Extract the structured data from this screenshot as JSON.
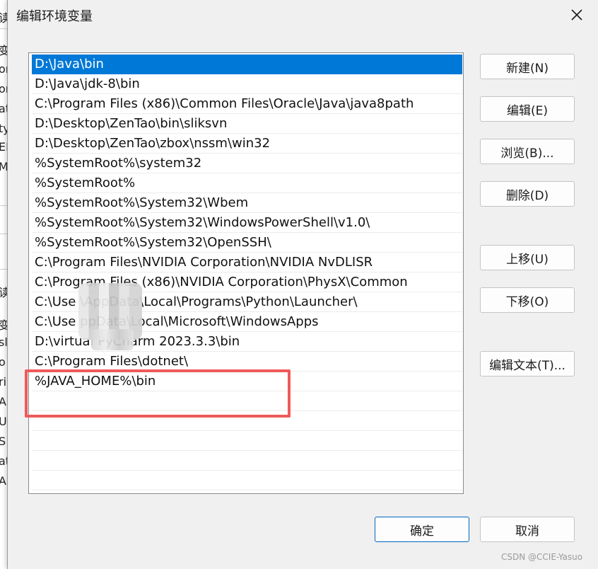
{
  "dialog": {
    "title": "编辑环境变量"
  },
  "paths": [
    "D:\\Java\\bin",
    "D:\\Java\\jdk-8\\bin",
    "C:\\Program Files (x86)\\Common Files\\Oracle\\Java\\java8path",
    "D:\\Desktop\\ZenTao\\bin\\sliksvn",
    "D:\\Desktop\\ZenTao\\zbox\\nssm\\win32",
    "%SystemRoot%\\system32",
    "%SystemRoot%",
    "%SystemRoot%\\System32\\Wbem",
    "%SystemRoot%\\System32\\WindowsPowerShell\\v1.0\\",
    "%SystemRoot%\\System32\\OpenSSH\\",
    "C:\\Program Files\\NVIDIA Corporation\\NVIDIA NvDLISR",
    "C:\\Program Files (x86)\\NVIDIA Corporation\\PhysX\\Common",
    "C:\\Use        \\AppData\\Local\\Programs\\Python\\Launcher\\",
    "C:\\Use        ppData\\Local\\Microsoft\\WindowsApps",
    "D:\\virtual        PyCharm 2023.3.3\\bin",
    "C:\\Program Files\\dotnet\\",
    "%JAVA_HOME%\\bin",
    "",
    "",
    "",
    "",
    ""
  ],
  "selected_index": 0,
  "buttons": {
    "new": "新建(N)",
    "edit": "编辑(E)",
    "browse": "浏览(B)...",
    "delete": "删除(D)",
    "move_up": "上移(U)",
    "move_down": "下移(O)",
    "edit_text": "编辑文本(T)...",
    "ok": "确定",
    "cancel": "取消"
  },
  "background_fragments": [
    "读",
    "变",
    "on",
    "on",
    "at",
    "ty",
    "EI",
    "M",
    "读",
    "变",
    "sl",
    "o",
    "ri",
    "A",
    "U",
    "S",
    "at",
    "A"
  ],
  "watermark": "CSDN @CCIE-Yasuo",
  "colors": {
    "selection": "#0078d7",
    "highlight_border": "#ef5a5a",
    "primary_border": "#0067c0"
  }
}
